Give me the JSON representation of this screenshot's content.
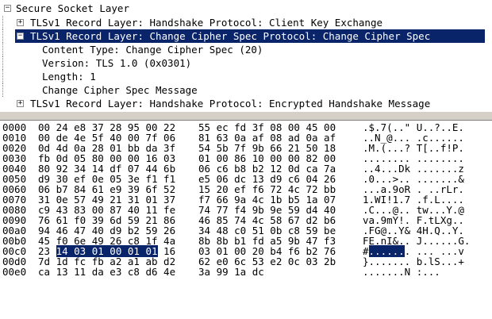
{
  "packet_details": {
    "root": {
      "label": "Secure Socket Layer"
    },
    "records": [
      {
        "toggle": "+",
        "label": "TLSv1 Record Layer: Handshake Protocol: Client Key Exchange"
      },
      {
        "toggle": "−",
        "label": "TLSv1 Record Layer: Change Cipher Spec Protocol: Change Cipher Spec",
        "selected": true,
        "fields": [
          "Content Type: Change Cipher Spec (20)",
          "Version: TLS 1.0 (0x0301)",
          "Length: 1",
          "Change Cipher Spec Message"
        ]
      },
      {
        "toggle": "+",
        "label": "TLSv1 Record Layer: Handshake Protocol: Encrypted Handshake Message"
      }
    ]
  },
  "packet_bytes": {
    "rows": [
      {
        "offset": "0000",
        "hex1": "00 24 e8 37 28 95 00 22",
        "hex2": "55 ec fd 3f 08 00 45 00",
        "ascii": ".$.7(..\" U..?..E."
      },
      {
        "offset": "0010",
        "hex1": "00 de 4e 5f 40 00 7f 06",
        "hex2": "81 63 0a af 08 ad 0a af",
        "ascii": "..N_@... .c......"
      },
      {
        "offset": "0020",
        "hex1": "0d 4d 0a 28 01 bb da 3f",
        "hex2": "54 5b 7f 9b 66 21 50 18",
        "ascii": ".M.(...? T[..f!P."
      },
      {
        "offset": "0030",
        "hex1": "fb 0d 05 80 00 00 16 03",
        "hex2": "01 00 86 10 00 00 82 00",
        "ascii": "........ ........"
      },
      {
        "offset": "0040",
        "hex1": "80 92 34 14 df 07 44 6b",
        "hex2": "06 c6 b8 b2 12 0d ca 7a",
        "ascii": "..4...Dk .......z"
      },
      {
        "offset": "0050",
        "hex1": "d9 30 ef 0e 05 3e f1 f1",
        "hex2": "e5 06 dc 13 d9 c6 04 26",
        "ascii": ".0...>.. .......&"
      },
      {
        "offset": "0060",
        "hex1": "06 b7 84 61 e9 39 6f 52",
        "hex2": "15 20 ef f6 72 4c 72 bb",
        "ascii": "...a.9oR . ..rLr."
      },
      {
        "offset": "0070",
        "hex1": "31 0e 57 49 21 31 01 37",
        "hex2": "f7 66 9a 4c 1b b5 1a 07",
        "ascii": "1.WI!1.7 .f.L...."
      },
      {
        "offset": "0080",
        "hex1": "c9 43 83 00 87 40 11 fe",
        "hex2": "74 77 f4 9b 9e 59 d4 40",
        "ascii": ".C...@.. tw...Y.@"
      },
      {
        "offset": "0090",
        "hex1": "76 61 f0 39 6d 59 21 86",
        "hex2": "46 85 74 4c 58 67 d2 b6",
        "ascii": "va.9mY!. F.tLXg.."
      },
      {
        "offset": "00a0",
        "hex1": "94 46 47 40 d9 b2 59 26",
        "hex2": "34 48 c0 51 0b c8 59 be",
        "ascii": ".FG@..Y& 4H.Q..Y."
      },
      {
        "offset": "00b0",
        "hex1": "45 f0 6e 49 26 c8 1f 4a",
        "hex2": "8b 8b b1 fd a5 9b 47 f3",
        "ascii": "FE.nI&.. J......G."
      },
      {
        "offset": "00c0",
        "hex1": "23 14 03 01 00 01 01 16",
        "hex2": "03 01 00 20 b4 f6 b2 76",
        "ascii": "#....... ... ...v",
        "highlight": true
      },
      {
        "offset": "00d0",
        "hex1": "7d 1d fc fb a2 a1 ab d2",
        "hex2": "62 e0 6c 53 e2 0c 03 2b",
        "ascii": "}....... b.lS...+"
      },
      {
        "offset": "00e0",
        "hex1": "ca 13 11 da e3 c8 d6 4e",
        "hex2": "3a 99 1a dc",
        "ascii": ".......N :..."
      }
    ],
    "selection": {
      "hex": "14 03 01 00 01 01",
      "ascii": "......"
    }
  }
}
